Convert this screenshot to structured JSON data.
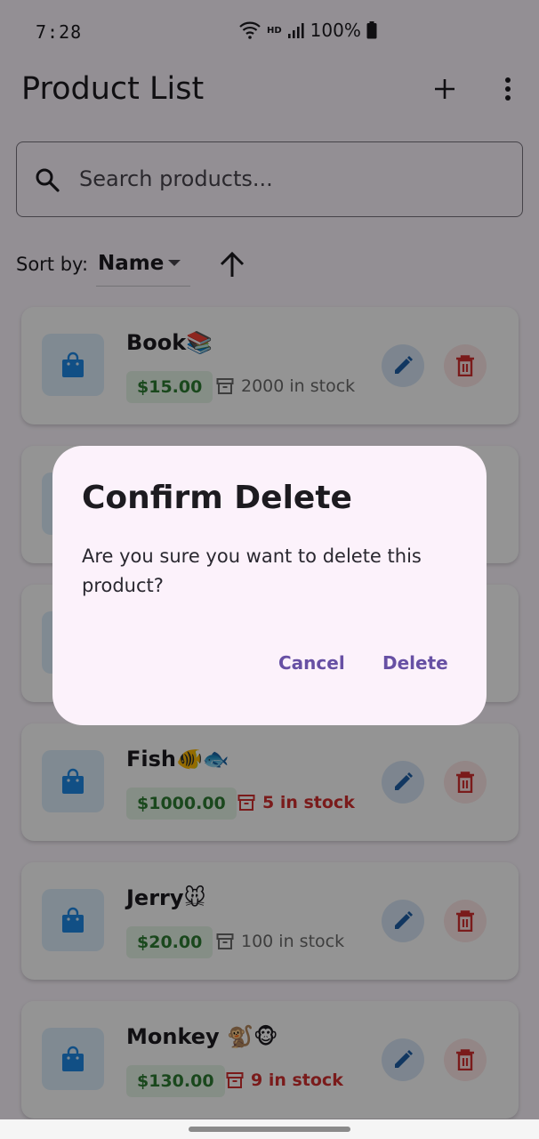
{
  "status": {
    "time": "7:28",
    "battery": "100%",
    "network": "HD"
  },
  "app": {
    "title": "Product List"
  },
  "search": {
    "placeholder": "Search products..."
  },
  "sort": {
    "label": "Sort by:",
    "value": "Name"
  },
  "products": [
    {
      "name": "Book📚",
      "price": "$15.00",
      "stock": "2000 in stock",
      "low": false
    },
    {
      "name": "",
      "price": "",
      "stock": "",
      "low": false
    },
    {
      "name": "",
      "price": "",
      "stock": "",
      "low": false
    },
    {
      "name": "Fish🐠🐟",
      "price": "$1000.00",
      "stock": "5 in stock",
      "low": true
    },
    {
      "name": "Jerry🐭",
      "price": "$20.00",
      "stock": "100 in stock",
      "low": false
    },
    {
      "name": "Monkey 🐒🐵",
      "price": "$130.00",
      "stock": "9 in stock",
      "low": true
    }
  ],
  "dialog": {
    "title": "Confirm Delete",
    "message": "Are you sure you want to delete this product?",
    "cancel": "Cancel",
    "confirm": "Delete"
  },
  "colors": {
    "accent": "#6750a4",
    "price_green": "#2e7d32",
    "low_stock_red": "#d32f2f",
    "edit_blue": "#1e5fa8"
  },
  "icons": [
    "wifi-icon",
    "signal-icon",
    "battery-icon",
    "add-icon",
    "more-vert-icon",
    "search-icon",
    "dropdown-caret-icon",
    "arrow-up-icon",
    "shopping-bag-icon",
    "archive-icon",
    "edit-icon",
    "delete-icon"
  ]
}
